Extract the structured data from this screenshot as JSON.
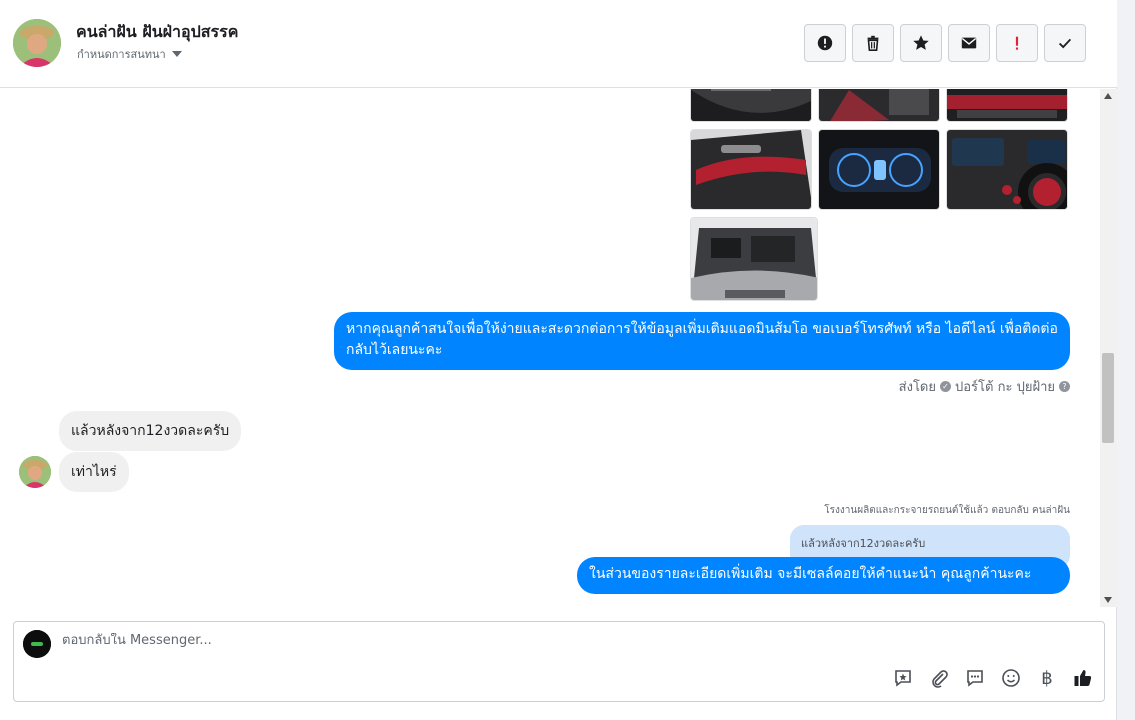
{
  "header": {
    "contact_name": "คนล่าฝัน ฝันฝ่าอุปสรรค",
    "assign_label": "กำหนดการสนทนา"
  },
  "actions": [
    {
      "name": "mark-spam-button",
      "icon": "alert-circle-icon"
    },
    {
      "name": "delete-button",
      "icon": "trash-icon"
    },
    {
      "name": "star-button",
      "icon": "star-icon"
    },
    {
      "name": "mark-unread-button",
      "icon": "envelope-icon"
    },
    {
      "name": "follow-up-button",
      "icon": "exclamation-icon"
    },
    {
      "name": "mark-done-button",
      "icon": "check-icon"
    }
  ],
  "thread": {
    "outgoing_1": "หากคุณลูกค้าสนใจเพื่อให้ง่ายและสะดวกต่อการให้ข้อมูลเพิ่มเติมแอดมินส้มโอ ขอเบอร์โทรศัพท์ หรือ ไอดีไลน์ เพื่อติดต่อกลับไว้เลยนะคะ",
    "sent_by": "ส่งโดย",
    "sender_name": "ปอร์โต้ กะ ปุยฝ้าย",
    "incoming_1": "แล้วหลังจาก12งวดละครับ",
    "incoming_2": "เท่าไหร่",
    "reply_label": "โรงงานผลิตและกระจายรถยนต์ใช้แล้ว ตอบกลับ คนล่าฝัน",
    "quoted_text": "แล้วหลังจาก12งวดละครับ",
    "outgoing_2": "ในส่วนของรายละเอียดเพิ่มเติม จะมีเซลล์คอยให้คำแนะนำ คุณลูกค้านะคะ"
  },
  "composer": {
    "placeholder": "ตอบกลับใน Messenger...",
    "currency_symbol": "฿"
  },
  "colors": {
    "outgoing_bubble": "#0084ff",
    "incoming_bubble": "#f0f0f0",
    "follow_up_accent": "#e41e3f"
  }
}
